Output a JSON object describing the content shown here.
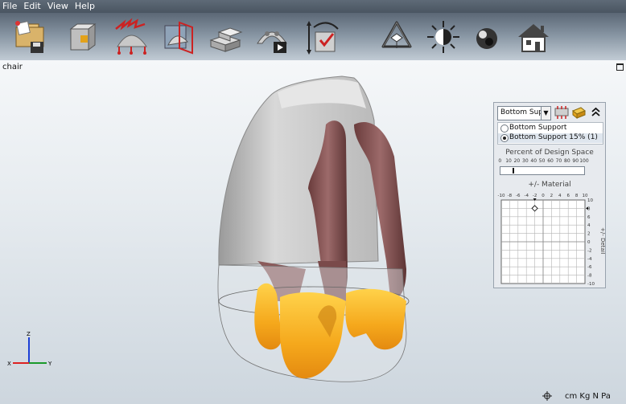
{
  "menu": [
    "File",
    "Edit",
    "View",
    "Help"
  ],
  "toolbar": [
    {
      "icon": "open-file-icon",
      "label": "open-save"
    },
    {
      "icon": "design-space-icon",
      "label": "design space"
    },
    {
      "icon": "loads-constraints-icon",
      "label": "loads and constraints"
    },
    {
      "icon": "symmetry-plane-icon",
      "label": "symmetry"
    },
    {
      "icon": "material-blocks-icon",
      "label": "materials"
    },
    {
      "icon": "run-optimization-icon",
      "label": "run"
    },
    {
      "icon": "measure-icon",
      "label": "measure"
    },
    {
      "icon": "view-cube-icon",
      "label": "view"
    },
    {
      "icon": "lighting-icon",
      "label": "lighting"
    },
    {
      "icon": "shading-icon",
      "label": "shading"
    },
    {
      "icon": "home-view-icon",
      "label": "home"
    }
  ],
  "viewport": {
    "model_name": "chair"
  },
  "panel": {
    "dropdown_value": "Bottom Suppo",
    "list": [
      {
        "label": "Bottom Support",
        "selected": false
      },
      {
        "label": "Bottom Support 15% (1)",
        "selected": true
      }
    ],
    "percent_label": "Percent of Design Space",
    "percent_ticks": [
      "0",
      "10",
      "20",
      "30",
      "40",
      "50",
      "60",
      "70",
      "80",
      "90",
      "100"
    ],
    "percent_value": 15,
    "material_label": "+/-  Material",
    "detail_label": "+/-  Detail",
    "material_ticks": [
      "-10",
      "-8",
      "-6",
      "-4",
      "-2",
      "0",
      "2",
      "4",
      "6",
      "8",
      "10"
    ],
    "detail_ticks": [
      "10",
      "8",
      "6",
      "4",
      "2",
      "0",
      "-2",
      "-4",
      "-6",
      "-8",
      "-10"
    ],
    "material_value": -2,
    "detail_value": 8
  },
  "status": {
    "units": "cm Kg N Pa"
  },
  "triad": {
    "x": "X",
    "y": "Y",
    "z": "Z"
  },
  "colors": {
    "support": "#f5a81c",
    "arms": "#7a4a4a",
    "shell": "#d0d0d0"
  }
}
